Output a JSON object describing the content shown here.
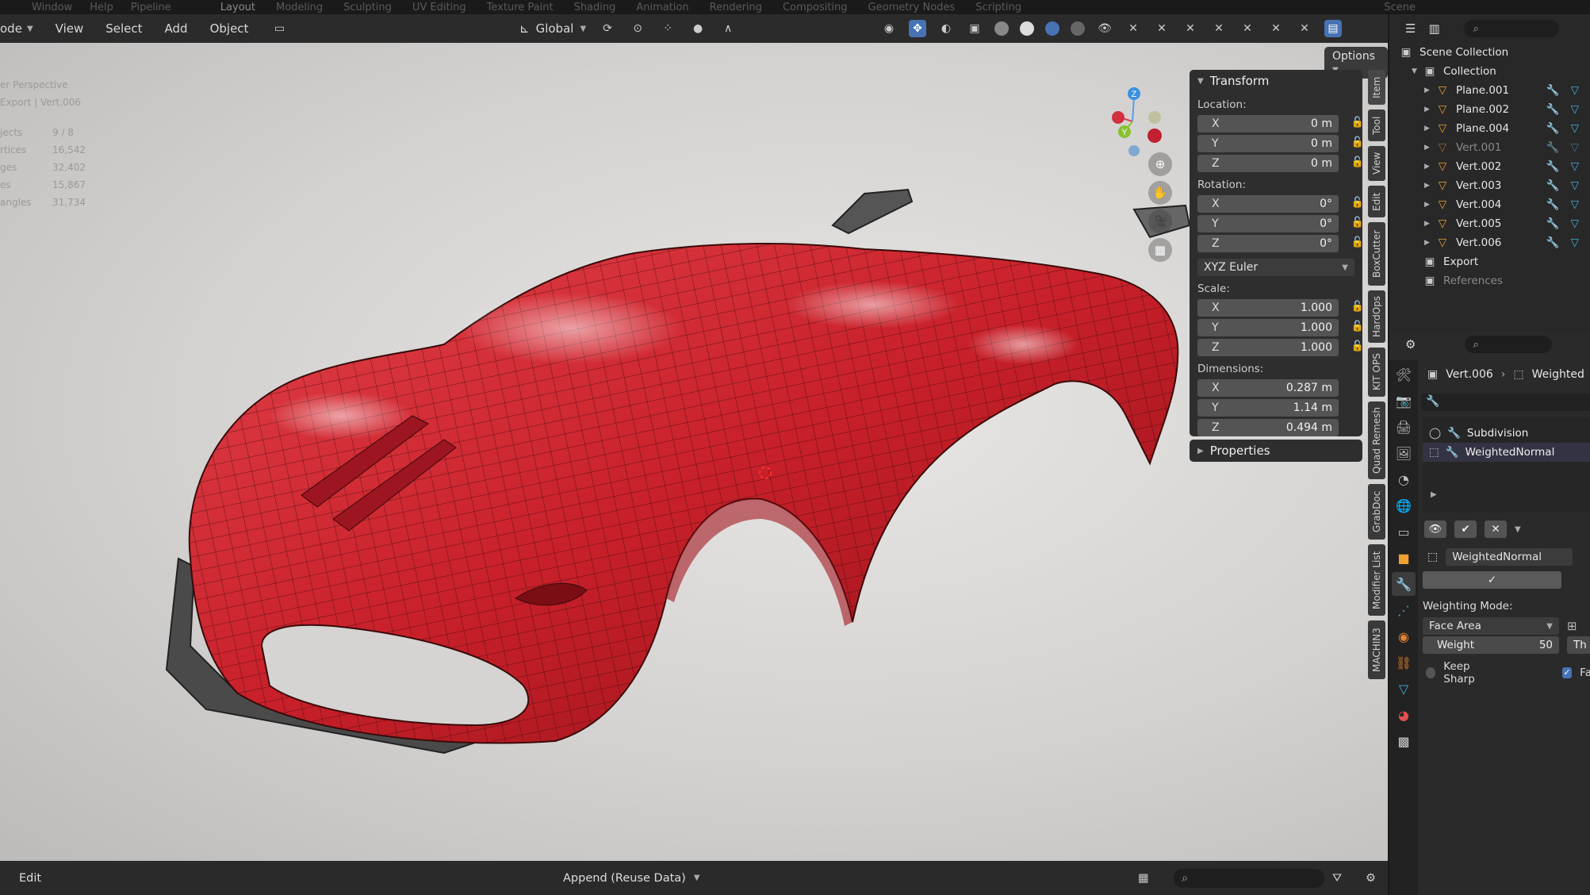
{
  "topbar": {
    "menus": [
      "Window",
      "Help",
      "Pipeline"
    ],
    "workspaces": [
      "Layout",
      "Modeling",
      "Sculpting",
      "UV Editing",
      "Texture Paint",
      "Shading",
      "Animation",
      "Rendering",
      "Compositing",
      "Geometry Nodes",
      "Scripting"
    ],
    "active_workspace": "Layout",
    "scene": "Scene"
  },
  "viewport_header": {
    "mode_label": "ode",
    "menus": [
      "View",
      "Select",
      "Add",
      "Object"
    ],
    "orientation": "Global",
    "options_label": "Options"
  },
  "overlay": {
    "view_name": "er Perspective",
    "collection_path": "Export | Vert.006",
    "stats": [
      {
        "key": "jects",
        "value": "9 / 8"
      },
      {
        "key": "rtices",
        "value": "16,542"
      },
      {
        "key": "ges",
        "value": "32,402"
      },
      {
        "key": "es",
        "value": "15,867"
      },
      {
        "key": "angles",
        "value": "31,734"
      }
    ]
  },
  "transform_panel": {
    "title": "Transform",
    "location_label": "Location:",
    "location": [
      {
        "axis": "X",
        "value": "0 m"
      },
      {
        "axis": "Y",
        "value": "0 m"
      },
      {
        "axis": "Z",
        "value": "0 m"
      }
    ],
    "rotation_label": "Rotation:",
    "rotation": [
      {
        "axis": "X",
        "value": "0°"
      },
      {
        "axis": "Y",
        "value": "0°"
      },
      {
        "axis": "Z",
        "value": "0°"
      }
    ],
    "rotation_mode": "XYZ Euler",
    "scale_label": "Scale:",
    "scale": [
      {
        "axis": "X",
        "value": "1.000"
      },
      {
        "axis": "Y",
        "value": "1.000"
      },
      {
        "axis": "Z",
        "value": "1.000"
      }
    ],
    "dimensions_label": "Dimensions:",
    "dimensions": [
      {
        "axis": "X",
        "value": "0.287 m"
      },
      {
        "axis": "Y",
        "value": "1.14 m"
      },
      {
        "axis": "Z",
        "value": "0.494 m"
      }
    ],
    "properties_title": "Properties"
  },
  "vertical_tabs": [
    "Item",
    "Tool",
    "View",
    "Edit",
    "BoxCutter",
    "HardOps",
    "KIT OPS",
    "Quad Remesh",
    "GrabDoc",
    "Modifier List",
    "MACHIN3"
  ],
  "gizmo": {
    "z": "Z",
    "y": "Y"
  },
  "outliner": {
    "root": "Scene Collection",
    "collection": "Collection",
    "objects": [
      {
        "name": "Plane.001",
        "dim": false
      },
      {
        "name": "Plane.002",
        "dim": false
      },
      {
        "name": "Plane.004",
        "dim": false
      },
      {
        "name": "Vert.001",
        "dim": true
      },
      {
        "name": "Vert.002",
        "dim": false
      },
      {
        "name": "Vert.003",
        "dim": false
      },
      {
        "name": "Vert.004",
        "dim": false
      },
      {
        "name": "Vert.005",
        "dim": false
      },
      {
        "name": "Vert.006",
        "dim": false
      }
    ],
    "export": "Export",
    "references": "References"
  },
  "properties": {
    "object": "Vert.006",
    "modifier_crumb": "Weighted",
    "modifiers": [
      "Subdivision",
      "WeightedNormal"
    ],
    "active_modifier": "WeightedNormal",
    "weighting_mode_label": "Weighting Mode:",
    "weighting_mode": "Face Area",
    "weight_label": "Weight",
    "weight_value": "50",
    "threshold_label": "Th",
    "keep_sharp_label": "Keep Sharp",
    "face_label": "Fa"
  },
  "bottombar": {
    "edit_label": "Edit",
    "append_label": "Append (Reuse Data)"
  },
  "colors": {
    "accent": "#4772b3",
    "car_red": "#c8202a",
    "mesh_icon": "#f0a030",
    "modifier_wrench": "#e09030",
    "filter_icon": "#40b0e0"
  }
}
